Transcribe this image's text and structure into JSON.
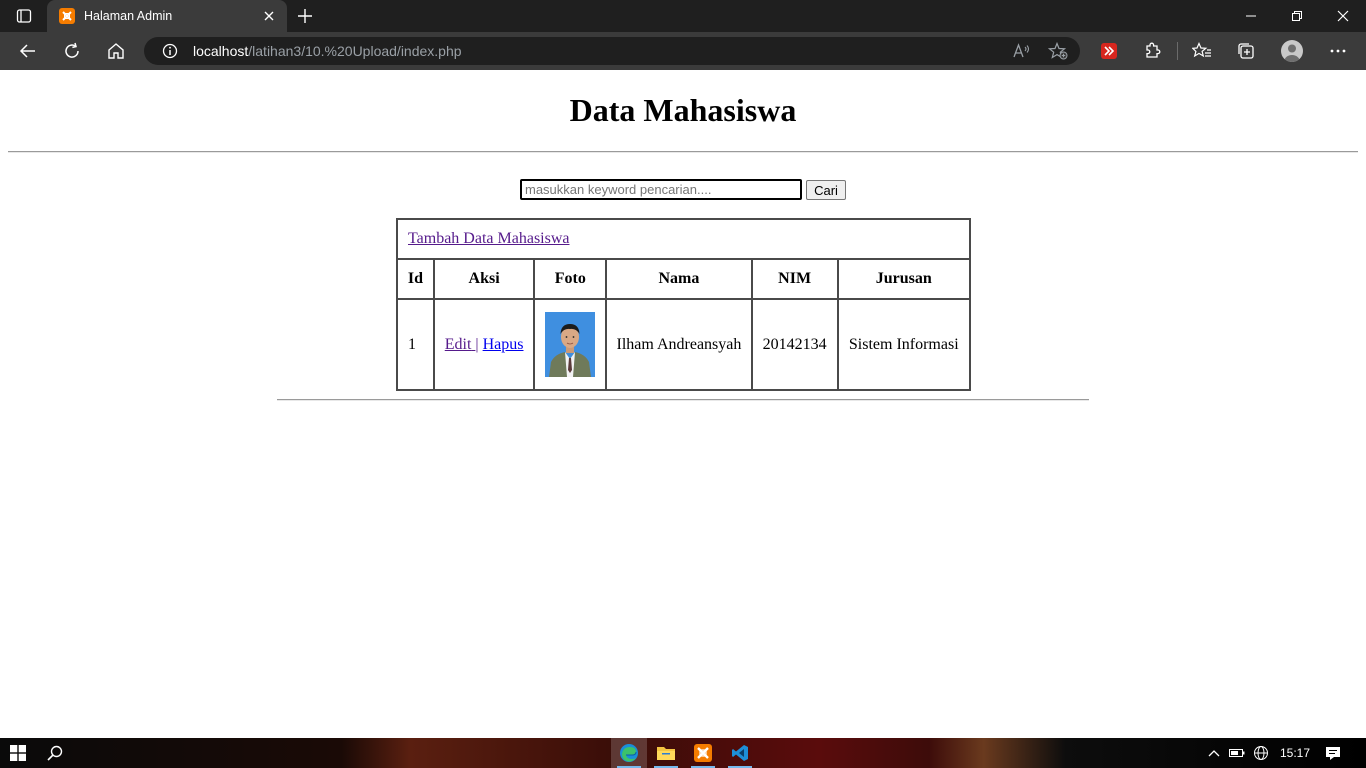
{
  "browser": {
    "tab_title": "Halaman Admin",
    "url_host": "localhost",
    "url_path": "/latihan3/10.%20Upload/index.php"
  },
  "page": {
    "heading": "Data Mahasiswa",
    "search": {
      "placeholder": "masukkan keyword pencarian....",
      "value": "",
      "button_label": "Cari"
    },
    "table": {
      "add_link": "Tambah Data Mahasiswa",
      "headers": [
        "Id",
        "Aksi",
        "Foto",
        "Nama",
        "NIM",
        "Jurusan"
      ],
      "rows": [
        {
          "id": "1",
          "edit_label": "Edit",
          "action_separator": "|",
          "delete_label": "Hapus",
          "photo": "student-photo",
          "nama": "Ilham Andreansyah",
          "nim": "20142134",
          "jurusan": "Sistem Informasi"
        }
      ]
    }
  },
  "taskbar": {
    "time": "15:17",
    "apps": [
      "edge-icon",
      "file-explorer-icon",
      "xampp-icon",
      "vscode-icon"
    ]
  },
  "colors": {
    "tab_bg": "#3b3b3b",
    "titlebar_bg": "#1f1f1f",
    "visited_link": "#551a8b",
    "link": "#0000ee",
    "photo_bg": "#3f8fe0"
  }
}
